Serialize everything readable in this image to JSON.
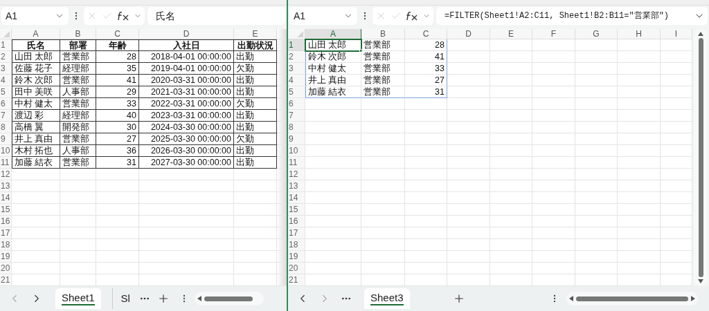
{
  "panes": [
    {
      "name_box": "A1",
      "formula": "氏名",
      "expand_button": false,
      "vscroll": false,
      "kind": "bordered",
      "columns": [
        {
          "label": "A",
          "selected": false,
          "kind": "text"
        },
        {
          "label": "B",
          "selected": false,
          "kind": "text"
        },
        {
          "label": "C",
          "selected": false,
          "kind": "number"
        },
        {
          "label": "D",
          "selected": false,
          "kind": "number"
        },
        {
          "label": "E",
          "selected": false,
          "kind": "text"
        }
      ],
      "rows": [
        {
          "label": "1",
          "selected": false,
          "kind": "header",
          "cells": [
            {
              "text": "氏名",
              "selected": false
            },
            {
              "text": "部署",
              "selected": false
            },
            {
              "text": "年齢",
              "selected": false
            },
            {
              "text": "入社日",
              "selected": false
            },
            {
              "text": "出勤状況",
              "selected": false
            }
          ]
        },
        {
          "label": "2",
          "selected": false,
          "kind": "data",
          "cells": [
            {
              "text": "山田 太郎",
              "selected": false
            },
            {
              "text": "営業部",
              "selected": false
            },
            {
              "text": "28",
              "selected": false
            },
            {
              "text": "2018-04-01 00:00:00",
              "selected": false
            },
            {
              "text": "出勤",
              "selected": false
            }
          ]
        },
        {
          "label": "3",
          "selected": false,
          "kind": "data",
          "cells": [
            {
              "text": "佐藤 花子",
              "selected": false
            },
            {
              "text": "経理部",
              "selected": false
            },
            {
              "text": "35",
              "selected": false
            },
            {
              "text": "2019-04-01 00:00:00",
              "selected": false
            },
            {
              "text": "欠勤",
              "selected": false
            }
          ]
        },
        {
          "label": "4",
          "selected": false,
          "kind": "data",
          "cells": [
            {
              "text": "鈴木 次郎",
              "selected": false
            },
            {
              "text": "営業部",
              "selected": false
            },
            {
              "text": "41",
              "selected": false
            },
            {
              "text": "2020-03-31 00:00:00",
              "selected": false
            },
            {
              "text": "出勤",
              "selected": false
            }
          ]
        },
        {
          "label": "5",
          "selected": false,
          "kind": "data",
          "cells": [
            {
              "text": "田中 美咲",
              "selected": false
            },
            {
              "text": "人事部",
              "selected": false
            },
            {
              "text": "29",
              "selected": false
            },
            {
              "text": "2021-03-31 00:00:00",
              "selected": false
            },
            {
              "text": "出勤",
              "selected": false
            }
          ]
        },
        {
          "label": "6",
          "selected": false,
          "kind": "data",
          "cells": [
            {
              "text": "中村 健太",
              "selected": false
            },
            {
              "text": "営業部",
              "selected": false
            },
            {
              "text": "33",
              "selected": false
            },
            {
              "text": "2022-03-31 00:00:00",
              "selected": false
            },
            {
              "text": "欠勤",
              "selected": false
            }
          ]
        },
        {
          "label": "7",
          "selected": false,
          "kind": "data",
          "cells": [
            {
              "text": "渡辺 彩",
              "selected": false
            },
            {
              "text": "経理部",
              "selected": false
            },
            {
              "text": "40",
              "selected": false
            },
            {
              "text": "2023-03-31 00:00:00",
              "selected": false
            },
            {
              "text": "出勤",
              "selected": false
            }
          ]
        },
        {
          "label": "8",
          "selected": false,
          "kind": "data",
          "cells": [
            {
              "text": "高橋 翼",
              "selected": false
            },
            {
              "text": "開発部",
              "selected": false
            },
            {
              "text": "30",
              "selected": false
            },
            {
              "text": "2024-03-30 00:00:00",
              "selected": false
            },
            {
              "text": "出勤",
              "selected": false
            }
          ]
        },
        {
          "label": "9",
          "selected": false,
          "kind": "data",
          "cells": [
            {
              "text": "井上 真由",
              "selected": false
            },
            {
              "text": "営業部",
              "selected": false
            },
            {
              "text": "27",
              "selected": false
            },
            {
              "text": "2025-03-30 00:00:00",
              "selected": false
            },
            {
              "text": "欠勤",
              "selected": false
            }
          ]
        },
        {
          "label": "10",
          "selected": false,
          "kind": "data",
          "cells": [
            {
              "text": "木村 拓也",
              "selected": false
            },
            {
              "text": "人事部",
              "selected": false
            },
            {
              "text": "36",
              "selected": false
            },
            {
              "text": "2026-03-30 00:00:00",
              "selected": false
            },
            {
              "text": "出勤",
              "selected": false
            }
          ]
        },
        {
          "label": "11",
          "selected": false,
          "kind": "data",
          "cells": [
            {
              "text": "加藤 結衣",
              "selected": false
            },
            {
              "text": "営業部",
              "selected": false
            },
            {
              "text": "31",
              "selected": false
            },
            {
              "text": "2027-03-30 00:00:00",
              "selected": false
            },
            {
              "text": "出勤",
              "selected": false
            }
          ]
        },
        {
          "label": "12",
          "selected": false,
          "kind": "blank"
        },
        {
          "label": "13",
          "selected": false,
          "kind": "blank"
        },
        {
          "label": "14",
          "selected": false,
          "kind": "blank"
        },
        {
          "label": "15",
          "selected": false,
          "kind": "blank"
        },
        {
          "label": "16",
          "selected": false,
          "kind": "blank"
        },
        {
          "label": "17",
          "selected": false,
          "kind": "blank"
        },
        {
          "label": "18",
          "selected": false,
          "kind": "blank"
        },
        {
          "label": "19",
          "selected": false,
          "kind": "blank"
        },
        {
          "label": "20",
          "selected": false,
          "kind": "blank"
        },
        {
          "label": "21",
          "selected": false,
          "kind": "blank"
        }
      ],
      "tab_bar": [
        {
          "kind": "prev",
          "disabled": true
        },
        {
          "kind": "next",
          "disabled": false
        },
        {
          "kind": "tab",
          "label": "Sheet1",
          "selected": true
        },
        {
          "kind": "tab",
          "label": "Sl",
          "selected": false
        },
        {
          "kind": "more"
        },
        {
          "kind": "add"
        },
        {
          "kind": "options"
        },
        {
          "kind": "hscroll"
        }
      ]
    },
    {
      "name_box": "A1",
      "formula": "=FILTER(Sheet1!A2:C11, Sheet1!B2:B11=\"営業部\")",
      "expand_button": true,
      "vscroll": true,
      "kind": "spill",
      "columns": [
        {
          "label": "A",
          "selected": true,
          "kind": "text"
        },
        {
          "label": "B",
          "selected": false,
          "kind": "text"
        },
        {
          "label": "C",
          "selected": false,
          "kind": "number"
        },
        {
          "label": "D",
          "selected": false,
          "kind": "text"
        },
        {
          "label": "E",
          "selected": false,
          "kind": "text"
        },
        {
          "label": "F",
          "selected": false,
          "kind": "text"
        },
        {
          "label": "G",
          "selected": false,
          "kind": "text"
        },
        {
          "label": "H",
          "selected": false,
          "kind": "text"
        },
        {
          "label": "I",
          "selected": false,
          "kind": "text"
        }
      ],
      "rows": [
        {
          "label": "1",
          "selected": true,
          "kind": "data",
          "cells": [
            {
              "text": "山田 太郎",
              "selected": true
            },
            {
              "text": "営業部",
              "selected": false
            },
            {
              "text": "28",
              "selected": false
            }
          ]
        },
        {
          "label": "2",
          "selected": false,
          "kind": "data",
          "cells": [
            {
              "text": "鈴木 次郎",
              "selected": false
            },
            {
              "text": "営業部",
              "selected": false
            },
            {
              "text": "41",
              "selected": false
            }
          ]
        },
        {
          "label": "3",
          "selected": false,
          "kind": "data",
          "cells": [
            {
              "text": "中村 健太",
              "selected": false
            },
            {
              "text": "営業部",
              "selected": false
            },
            {
              "text": "33",
              "selected": false
            }
          ]
        },
        {
          "label": "4",
          "selected": false,
          "kind": "data",
          "cells": [
            {
              "text": "井上 真由",
              "selected": false
            },
            {
              "text": "営業部",
              "selected": false
            },
            {
              "text": "27",
              "selected": false
            }
          ]
        },
        {
          "label": "5",
          "selected": false,
          "kind": "data",
          "cells": [
            {
              "text": "加藤 結衣",
              "selected": false
            },
            {
              "text": "営業部",
              "selected": false
            },
            {
              "text": "31",
              "selected": false
            }
          ]
        },
        {
          "label": "6",
          "selected": false,
          "kind": "blank"
        },
        {
          "label": "7",
          "selected": false,
          "kind": "blank"
        },
        {
          "label": "8",
          "selected": false,
          "kind": "blank"
        },
        {
          "label": "9",
          "selected": false,
          "kind": "blank"
        },
        {
          "label": "10",
          "selected": false,
          "kind": "blank"
        },
        {
          "label": "11",
          "selected": false,
          "kind": "blank"
        },
        {
          "label": "12",
          "selected": false,
          "kind": "blank"
        },
        {
          "label": "13",
          "selected": false,
          "kind": "blank"
        },
        {
          "label": "14",
          "selected": false,
          "kind": "blank"
        },
        {
          "label": "15",
          "selected": false,
          "kind": "blank"
        },
        {
          "label": "16",
          "selected": false,
          "kind": "blank"
        },
        {
          "label": "17",
          "selected": false,
          "kind": "blank"
        },
        {
          "label": "18",
          "selected": false,
          "kind": "blank"
        },
        {
          "label": "19",
          "selected": false,
          "kind": "blank"
        },
        {
          "label": "20",
          "selected": false,
          "kind": "blank"
        },
        {
          "label": "21",
          "selected": false,
          "kind": "blank"
        }
      ],
      "tab_bar": [
        {
          "kind": "prev",
          "disabled": false
        },
        {
          "kind": "next",
          "disabled": true
        },
        {
          "kind": "more"
        },
        {
          "kind": "tab",
          "label": "Sheet3",
          "selected": true
        },
        {
          "kind": "add"
        },
        {
          "kind": "options"
        },
        {
          "kind": "hscroll"
        }
      ]
    }
  ]
}
